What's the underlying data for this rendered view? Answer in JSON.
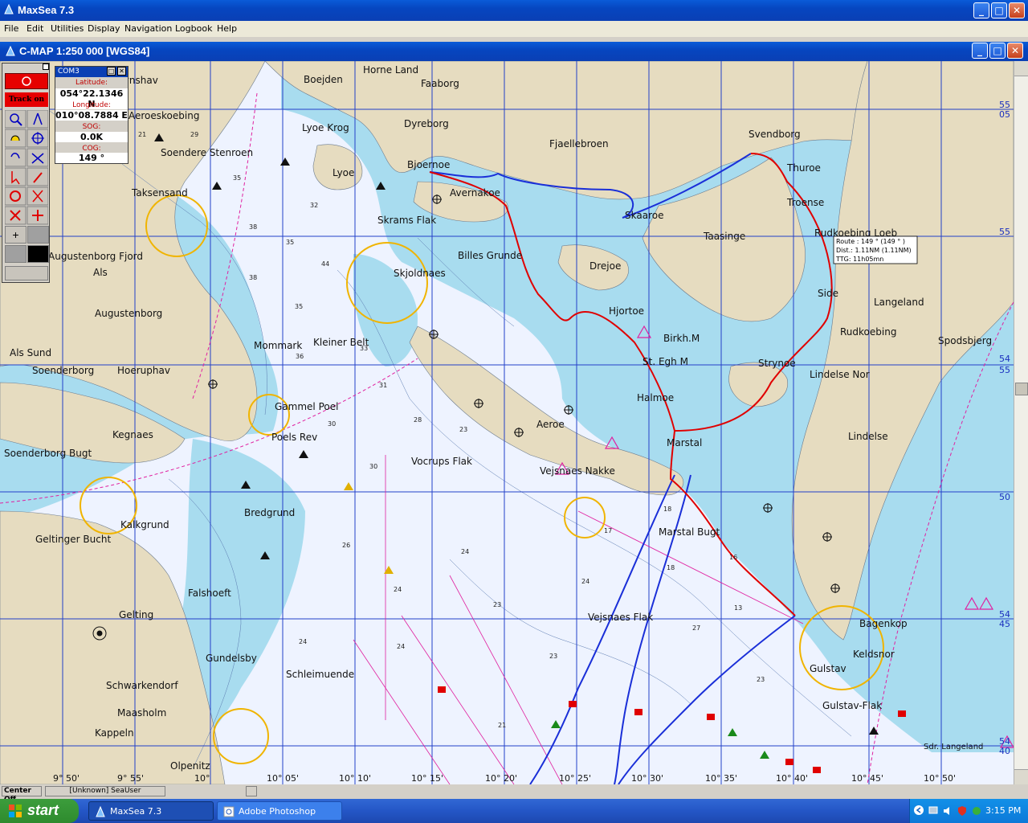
{
  "app": {
    "title": "MaxSea 7.3",
    "accent": "#0a3fb4"
  },
  "menu": [
    "File",
    "Edit",
    "Utilities",
    "Display",
    "Navigation",
    "Logbook",
    "Help"
  ],
  "chart_window": {
    "title": "C-MAP  1:250 000 [WGS84]"
  },
  "toolbox": {
    "track_label": "Track on",
    "button_color": "#e60000"
  },
  "gps": {
    "title": "COM3",
    "lat_label": "Latitude:",
    "lat": "054°22.1346 N",
    "lon_label": "Longitude:",
    "lon": "010°08.7884 E",
    "sog_label": "SOG:",
    "sog": "0.0K",
    "cog_label": "COG:",
    "cog": "149 °"
  },
  "route_tooltip": [
    "Route : 149 ° (149 ° )",
    "Dist.: 1.11NM (1.11NM)",
    "TTG: 11h05mn"
  ],
  "places": [
    "Horne Land",
    "Faaborg",
    "Boejden",
    "Lyoe Krog",
    "Dyreborg",
    "Fjaellebroen",
    "Svendborg",
    "Thuroe",
    "Lyoe",
    "Bjoernoe",
    "Avernakoe",
    "Skaaroe",
    "Troense",
    "Skrams Flak",
    "Taasinge",
    "Rudkoebing Loeb",
    "Billes Grunde",
    "Drejoe",
    "Skjoldnaes",
    "Hjortoe",
    "Side",
    "Langeland",
    "Birkh.M",
    "Rudkoebing",
    "Spodsbjerg",
    "St. Egh M",
    "Strynoe",
    "Lindelse Nor",
    "Halmoe",
    "Aeroe",
    "Lindelse",
    "Marstal",
    "Vejsnaes Nakke",
    "Vejsnaes Flak",
    "Marstal Bugt",
    "Bagenkop",
    "Keldsnor",
    "Gulstav",
    "Gulstav-Flak",
    "Sdr. Langeland",
    "Schleimuende",
    "Vocrups Flak",
    "Kleiner Belt",
    "Gammel Poel",
    "Poels Rev",
    "Bredgrund",
    "Kalkgrund",
    "Geltinger Bucht",
    "Soenderborg Bugt",
    "Kegnaes",
    "Soenderborg",
    "Hoeruphav",
    "Als Sund",
    "Augustenborg",
    "Als",
    "Augustenborg Fjord",
    "Mommark",
    "Taksensand",
    "Soendere Stenroen",
    "Fynshav",
    "Aeroeskoebing",
    "Falshoeft",
    "Gelting",
    "Gundelsby",
    "Schwarkendorf",
    "Maasholm",
    "Kappeln",
    "Olpenitz"
  ],
  "lat_labels": [
    "55",
    "05",
    "55",
    "54",
    "55",
    "50",
    "54",
    "45",
    "54",
    "40"
  ],
  "lon_labels": [
    "9° 50'",
    "9° 55'",
    "10°",
    "10° 05'",
    "10° 10'",
    "10° 15'",
    "10° 20'",
    "10° 25'",
    "10° 30'",
    "10° 35'",
    "10° 40'",
    "10° 45'",
    "10° 50'"
  ],
  "statusbar": {
    "center": "Center Off",
    "unknown": "[Unknown] SeaUser"
  },
  "taskbar": {
    "start": "start",
    "tasks": [
      "MaxSea 7.3",
      "Adobe Photoshop"
    ],
    "clock": "3:15 PM"
  }
}
